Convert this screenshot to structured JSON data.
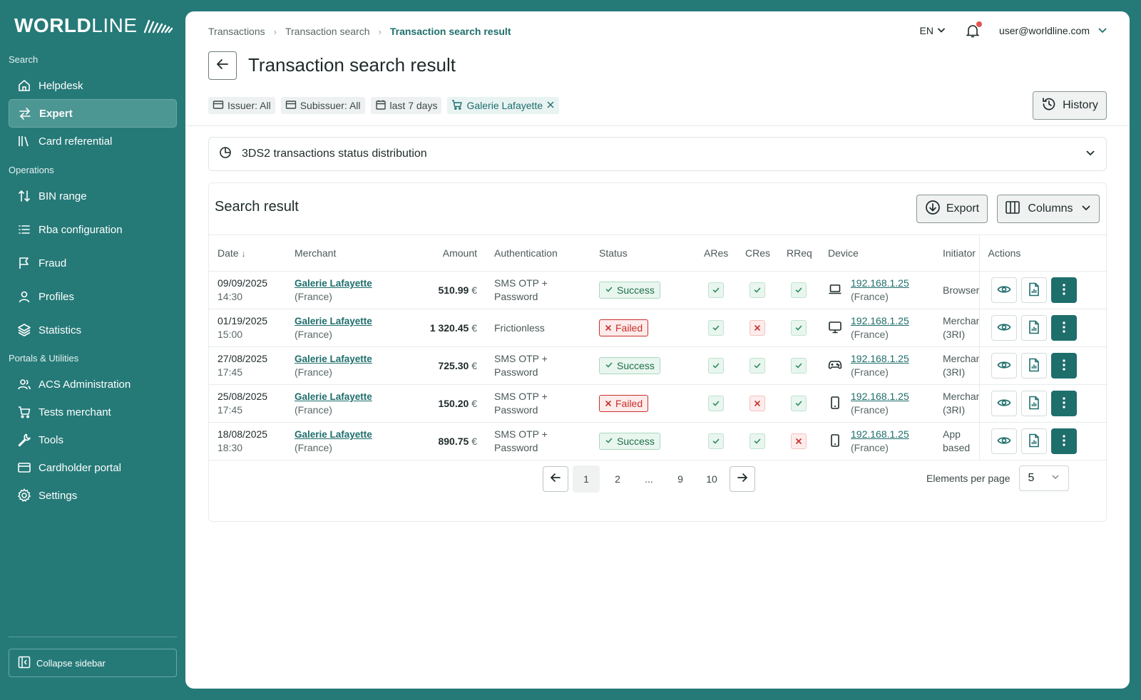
{
  "brand": {
    "logo_bold": "WORLD",
    "logo_light": "LINE"
  },
  "sidebar": {
    "sections": {
      "search": "Search",
      "operations": "Operations",
      "portals": "Portals & Utilities"
    },
    "items": [
      {
        "label": "Helpdesk",
        "icon": "home-icon"
      },
      {
        "label": "Expert",
        "icon": "transfer-icon",
        "active": true
      },
      {
        "label": "Card referential",
        "icon": "library-icon"
      },
      {
        "label": "BIN range",
        "icon": "sort-arrows-icon"
      },
      {
        "label": "Rba configuration",
        "icon": "list-icon"
      },
      {
        "label": "Fraud",
        "icon": "flag-icon"
      },
      {
        "label": "Profiles",
        "icon": "user-icon"
      },
      {
        "label": "Statistics",
        "icon": "layers-icon"
      },
      {
        "label": "ACS Administration",
        "icon": "users-icon"
      },
      {
        "label": "Tests merchant",
        "icon": "cart-icon"
      },
      {
        "label": "Tools",
        "icon": "wrench-icon"
      },
      {
        "label": "Cardholder portal",
        "icon": "card-icon"
      },
      {
        "label": "Settings",
        "icon": "gear-icon"
      }
    ],
    "collapse_label": "Collapse sidebar"
  },
  "header": {
    "breadcrumb": [
      "Transactions",
      "Transaction search",
      "Transaction search result"
    ],
    "language": "EN",
    "user_email": "user@worldline.com"
  },
  "page": {
    "title": "Transaction search result",
    "history_label": "History",
    "filters": [
      {
        "label": "Issuer: All",
        "icon": "card-icon"
      },
      {
        "label": "Subissuer: All",
        "icon": "card-icon"
      },
      {
        "label": "last 7 days",
        "icon": "calendar-icon"
      },
      {
        "label": "Galerie Lafayette",
        "icon": "cart-icon",
        "removable": true
      }
    ],
    "distribution_label": "3DS2 transactions status distribution"
  },
  "results": {
    "title": "Search result",
    "export_label": "Export",
    "columns_label": "Columns",
    "headers": {
      "date": "Date",
      "merchant": "Merchant",
      "amount": "Amount",
      "authentication": "Authentication",
      "status": "Status",
      "ares": "ARes",
      "cres": "CRes",
      "rreq": "RReq",
      "device": "Device",
      "initiator": "Initiator",
      "actions": "Actions"
    },
    "rows": [
      {
        "date": "09/09/2025",
        "time": "14:30",
        "merchant": "Galerie Lafayette",
        "country": "(France)",
        "amount": "510.99",
        "currency": "€",
        "auth1": "SMS OTP +",
        "auth2": "Password",
        "status": "Success",
        "ares": "ok",
        "cres": "ok",
        "rreq": "ok",
        "device_icon": "laptop-icon",
        "ip": "192.168.1.25",
        "ip_country": "(France)",
        "init1": "Browser",
        "init2": ""
      },
      {
        "date": "01/19/2025",
        "time": "15:00",
        "merchant": "Galerie Lafayette",
        "country": "(France)",
        "amount": "1 320.45",
        "currency": "€",
        "auth1": "Frictionless",
        "auth2": "",
        "status": "Failed",
        "ares": "ok",
        "cres": "ko",
        "rreq": "ok",
        "device_icon": "monitor-icon",
        "ip": "192.168.1.25",
        "ip_country": "(France)",
        "init1": "Merchant",
        "init2": "(3RI)"
      },
      {
        "date": "27/08/2025",
        "time": "17:45",
        "merchant": "Galerie Lafayette",
        "country": "(France)",
        "amount": "725.30",
        "currency": "€",
        "auth1": "SMS OTP +",
        "auth2": "Password",
        "status": "Success",
        "ares": "ok",
        "cres": "ok",
        "rreq": "ok",
        "device_icon": "gamepad-icon",
        "ip": "192.168.1.25",
        "ip_country": "(France)",
        "init1": "Merchant",
        "init2": "(3RI)"
      },
      {
        "date": "25/08/2025",
        "time": "17:45",
        "merchant": "Galerie Lafayette",
        "country": "(France)",
        "amount": "150.20",
        "currency": "€",
        "auth1": "SMS OTP +",
        "auth2": "Password",
        "status": "Failed",
        "ares": "ok",
        "cres": "ko",
        "rreq": "ok",
        "device_icon": "tablet-icon",
        "ip": "192.168.1.25",
        "ip_country": "(France)",
        "init1": "Merchant",
        "init2": "(3RI)"
      },
      {
        "date": "18/08/2025",
        "time": "18:30",
        "merchant": "Galerie Lafayette",
        "country": "(France)",
        "amount": "890.75",
        "currency": "€",
        "auth1": "SMS OTP +",
        "auth2": "Password",
        "status": "Success",
        "ares": "ok",
        "cres": "ok",
        "rreq": "ko",
        "device_icon": "tablet-icon",
        "ip": "192.168.1.25",
        "ip_country": "(France)",
        "init1": "App based",
        "init2": ""
      }
    ],
    "pagination": {
      "pages": [
        "1",
        "2",
        "...",
        "9",
        "10"
      ],
      "current": "1",
      "per_page_label": "Elements per page",
      "per_page_value": "5"
    }
  },
  "colors": {
    "brand_teal": "#257a78",
    "accent": "#1e6e6c",
    "success": "#1e6e4a",
    "danger": "#c8302a"
  }
}
